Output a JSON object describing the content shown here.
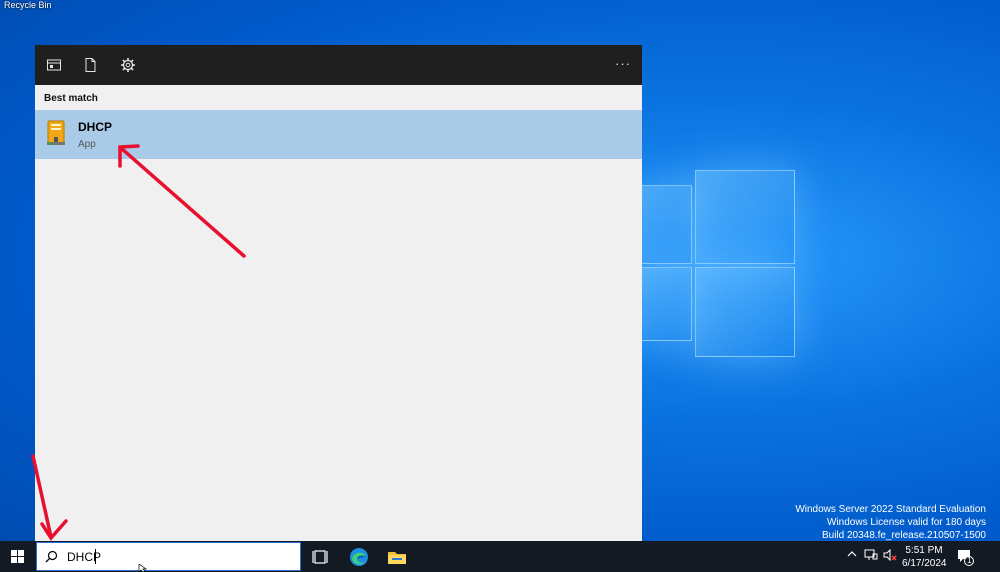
{
  "desktop": {
    "recycle_bin_label": "Recycle Bin"
  },
  "watermark": {
    "line1": "Windows Server 2022 Standard Evaluation",
    "line2": "Windows License valid for 180 days",
    "line3": "Build 20348.fe_release.210507-1500"
  },
  "start_panel": {
    "best_match_label": "Best match",
    "result": {
      "name": "DHCP",
      "type": "App"
    },
    "more_label": "···"
  },
  "taskbar": {
    "search_value": "DHCP",
    "clock_time": "5:51 PM",
    "clock_date": "6/17/2024",
    "notification_count": "1"
  },
  "colors": {
    "highlight": "#a9cbe8",
    "taskbar": "#141a24",
    "annotation_arrow": "#e8102e"
  }
}
